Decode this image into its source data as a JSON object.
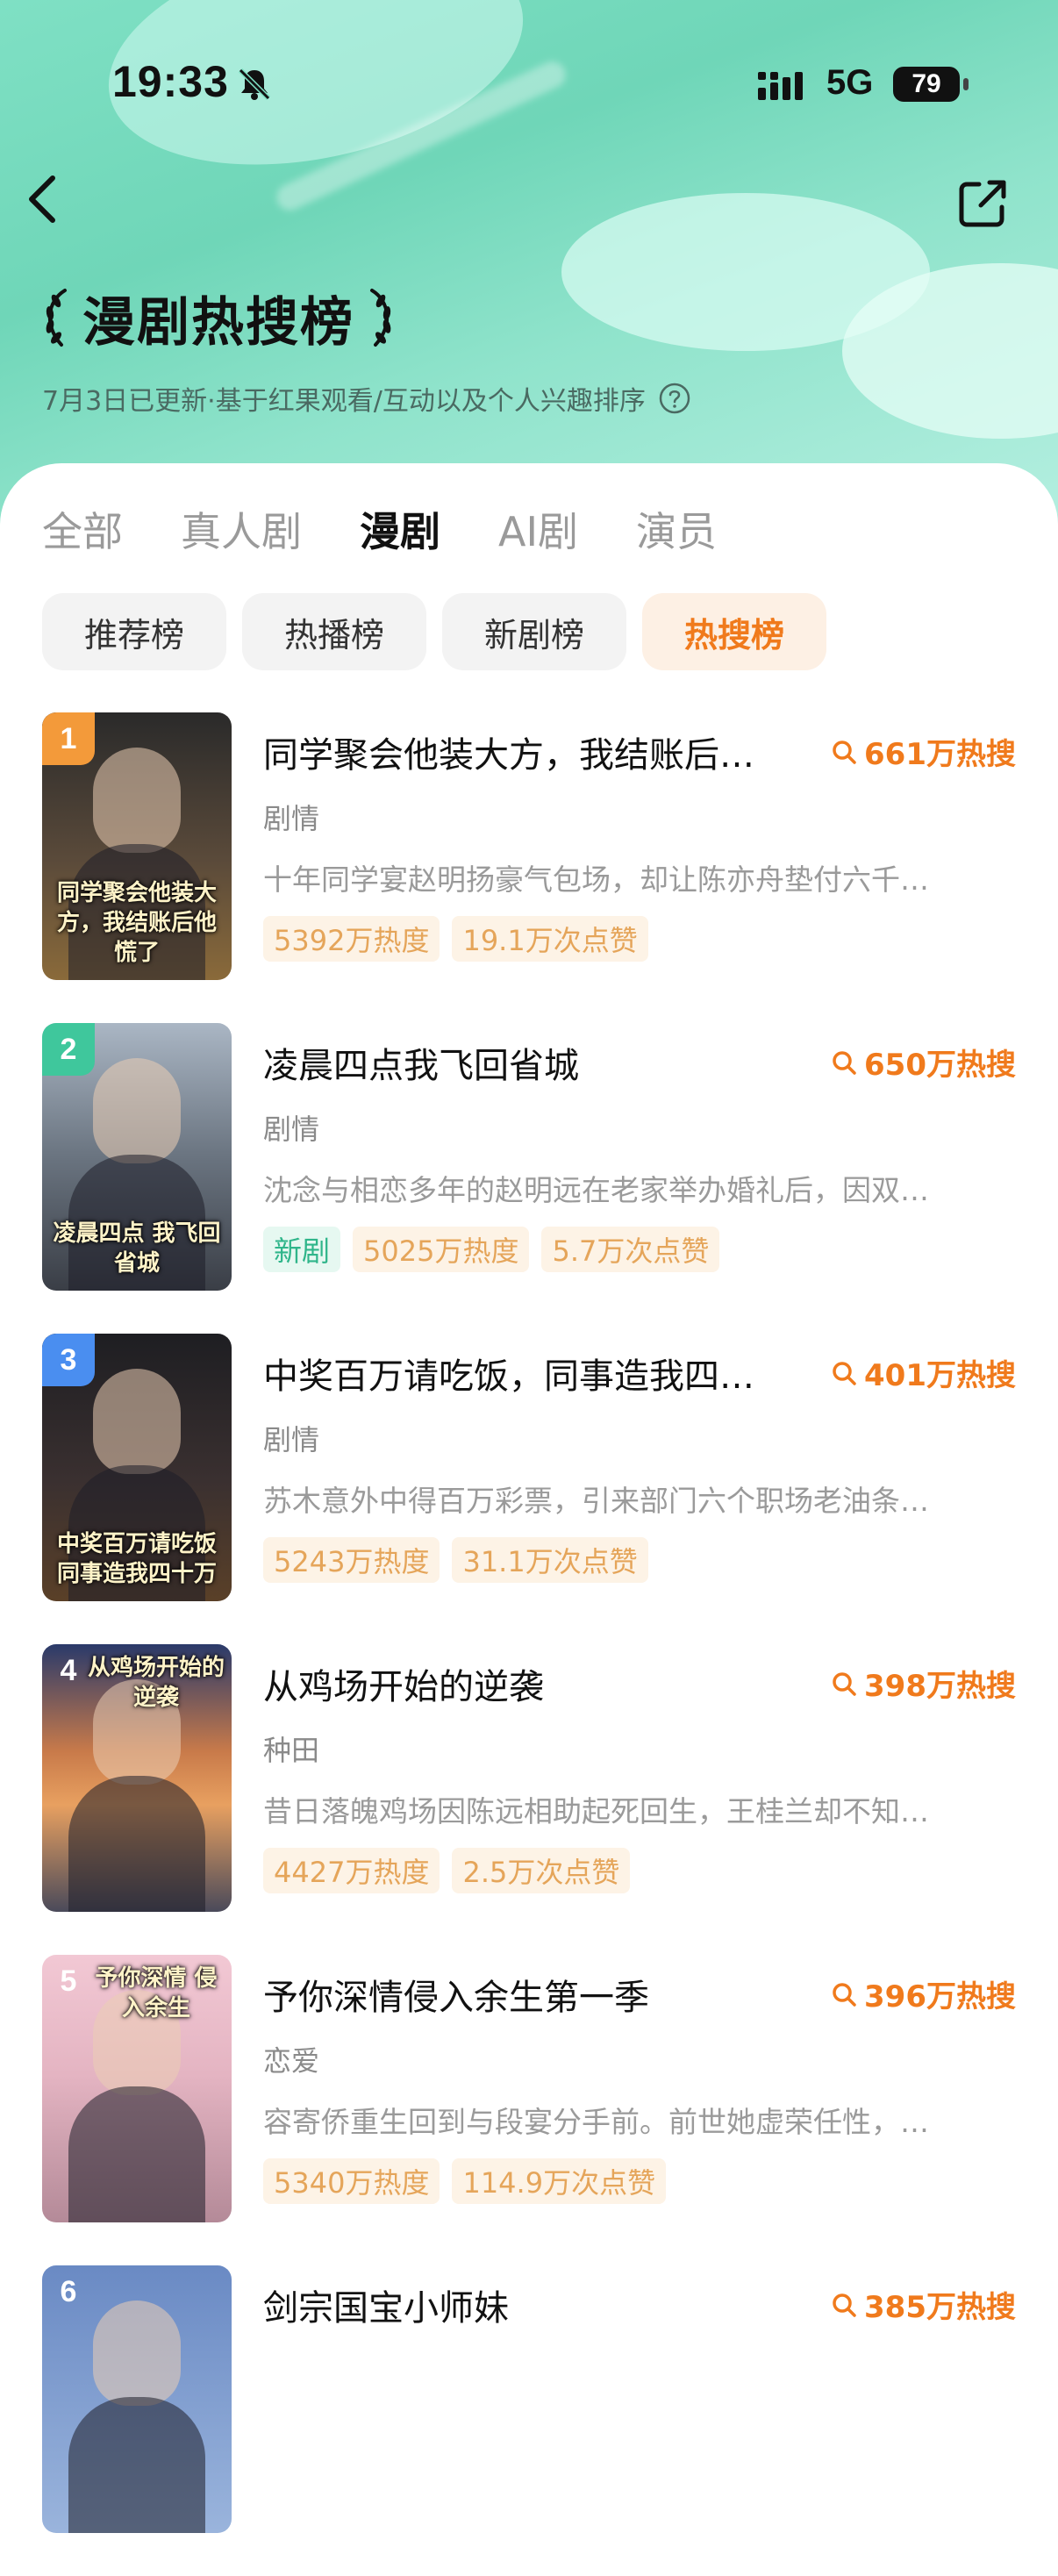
{
  "status": {
    "time": "19:33",
    "network": "5G",
    "battery": "79"
  },
  "header": {
    "title": "漫剧热搜榜",
    "subtitle": "7月3日已更新·基于红果观看/互动以及个人兴趣排序"
  },
  "tabs": [
    {
      "label": "全部",
      "active": false
    },
    {
      "label": "真人剧",
      "active": false
    },
    {
      "label": "漫剧",
      "active": true
    },
    {
      "label": "AI剧",
      "active": false
    },
    {
      "label": "演员",
      "active": false
    }
  ],
  "chips": [
    {
      "label": "推荐榜",
      "active": false
    },
    {
      "label": "热播榜",
      "active": false
    },
    {
      "label": "新剧榜",
      "active": false
    },
    {
      "label": "热搜榜",
      "active": true
    }
  ],
  "items": [
    {
      "rank": "1",
      "title": "同学聚会他装大方，我结账后…",
      "hot": "661万热搜",
      "genre": "剧情",
      "desc": "十年同学宴赵明扬豪气包场，却让陈亦舟垫付六千…",
      "tags": [
        "5392万热度",
        "19.1万次点赞"
      ],
      "new_tag": "",
      "cover_text": "同学聚会他装大方，我结账后他慌了",
      "rank_color": "#f39a3a",
      "cover_bg": "linear-gradient(180deg,#2a2a2a 0%,#5a4a3a 55%,#8a6a3a 100%)"
    },
    {
      "rank": "2",
      "title": "凌晨四点我飞回省城",
      "hot": "650万热搜",
      "genre": "剧情",
      "desc": "沈念与相恋多年的赵明远在老家举办婚礼后，因双…",
      "tags": [
        "5025万热度",
        "5.7万次点赞"
      ],
      "new_tag": "新剧",
      "cover_text": "凌晨四点 我飞回省城",
      "rank_color": "#3fc79c",
      "cover_bg": "linear-gradient(180deg,#aab6c4 0%,#6a7480 50%,#3a3e46 100%)"
    },
    {
      "rank": "3",
      "title": "中奖百万请吃饭，同事造我四…",
      "hot": "401万热搜",
      "genre": "剧情",
      "desc": "苏木意外中得百万彩票，引来部门六个职场老油条…",
      "tags": [
        "5243万热度",
        "31.1万次点赞"
      ],
      "new_tag": "",
      "cover_text": "中奖百万请吃饭 同事造我四十万",
      "rank_color": "#4a8ef0",
      "cover_bg": "linear-gradient(180deg,#1e1e22 0%,#3a3030 55%,#5a4028 100%)"
    },
    {
      "rank": "4",
      "title": "从鸡场开始的逆袭",
      "hot": "398万热搜",
      "genre": "种田",
      "desc": "昔日落魄鸡场因陈远相助起死回生，王桂兰却不知…",
      "tags": [
        "4427万热度",
        "2.5万次点赞"
      ],
      "new_tag": "",
      "cover_text": "",
      "cover_top_text": "从鸡场开始的逆袭",
      "rank_color": "rgba(0,0,0,0)",
      "cover_bg": "linear-gradient(180deg,#2a3a6a 0%,#c87a4a 40%,#e8a060 60%,#4a4a5a 100%)"
    },
    {
      "rank": "5",
      "title": "予你深情侵入余生第一季",
      "hot": "396万热搜",
      "genre": "恋爱",
      "desc": "容寄侨重生回到与段宴分手前。前世她虚荣任性，…",
      "tags": [
        "5340万热度",
        "114.9万次点赞"
      ],
      "new_tag": "",
      "cover_text": "",
      "cover_top_text": "予你深情 侵入余生",
      "rank_color": "rgba(0,0,0,0)",
      "cover_bg": "linear-gradient(180deg,#f2c8d4 0%,#e4b4c2 45%,#b48a98 100%)"
    },
    {
      "rank": "6",
      "title": "剑宗国宝小师妹",
      "hot": "385万热搜",
      "genre": "",
      "desc": "",
      "tags": [],
      "new_tag": "",
      "cover_text": "",
      "rank_color": "rgba(0,0,0,0)",
      "cover_bg": "linear-gradient(180deg,#6a8ac4 0%,#9ab4dc 100%)"
    }
  ]
}
